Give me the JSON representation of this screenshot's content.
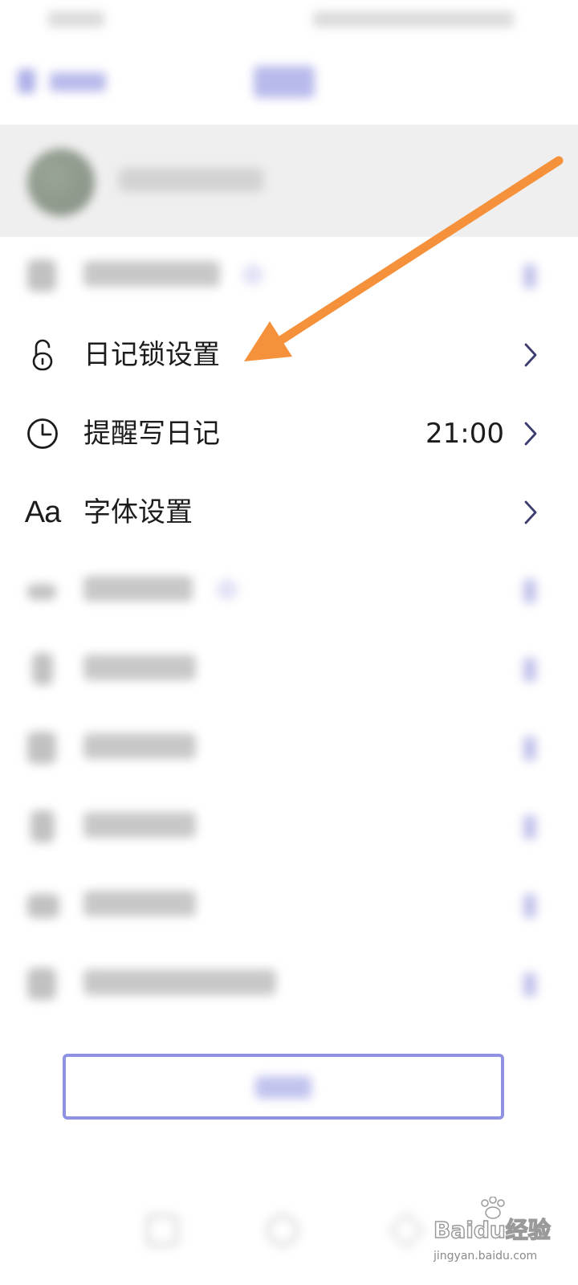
{
  "settings": {
    "rows": [
      {
        "key": "diary-lock",
        "label": "日记锁设置",
        "icon": "lock-icon"
      },
      {
        "key": "reminder",
        "label": "提醒写日记",
        "value": "21:00",
        "icon": "clock-icon"
      },
      {
        "key": "font",
        "label": "字体设置",
        "icon": "font-icon",
        "icon_text": "Aa"
      }
    ]
  },
  "annotation": {
    "color": "#f5913b"
  },
  "colors": {
    "accent": "#6b6fd6",
    "chevron": "#3b3d6e",
    "profile_bg": "#efefef"
  },
  "watermark": {
    "text": "Baidu经验",
    "sub": "jingyan.baidu.com"
  }
}
